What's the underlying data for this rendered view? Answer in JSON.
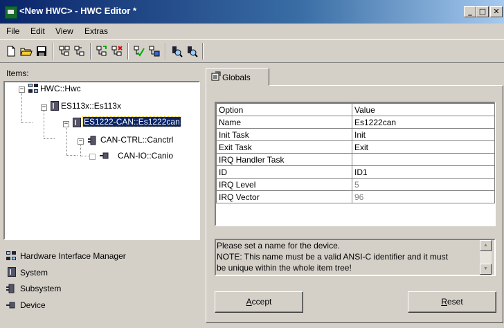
{
  "window": {
    "title": "<New HWC> - HWC Editor  *",
    "controls": {
      "minimize": "_",
      "maximize": "□",
      "close": "✕"
    }
  },
  "menu": [
    "File",
    "Edit",
    "View",
    "Extras"
  ],
  "toolbar": {
    "icons": [
      "new-file-icon",
      "open-folder-icon",
      "save-icon",
      "tree-add-icon",
      "tree-remove-icon",
      "tree-insert-icon",
      "tree-delete-icon",
      "check-icon",
      "build-icon",
      "find-icon",
      "find-next-icon"
    ]
  },
  "items_panel": {
    "label": "Items:",
    "tree": [
      {
        "label": "HWC::Hwc",
        "icon": "hwc-icon",
        "expander": "−"
      },
      {
        "label": "ES113x::Es113x",
        "icon": "system-icon",
        "expander": "−"
      },
      {
        "label": "ES1222-CAN::Es1222can",
        "icon": "system-icon",
        "expander": "−",
        "selected": true
      },
      {
        "label": "CAN-CTRL::Canctrl",
        "icon": "subsystem-icon",
        "expander": "−"
      },
      {
        "label": "CAN-IO::Canio",
        "icon": "device-icon",
        "expander": ""
      }
    ]
  },
  "legend": [
    {
      "label": "Hardware Interface Manager",
      "icon": "hwc-icon"
    },
    {
      "label": "System",
      "icon": "system-icon"
    },
    {
      "label": "Subsystem",
      "icon": "subsystem-icon"
    },
    {
      "label": "Device",
      "icon": "device-icon"
    }
  ],
  "tab": {
    "label": "Globals",
    "icon": "globals-icon"
  },
  "grid": {
    "headers": [
      "Option",
      "Value"
    ],
    "rows": [
      {
        "option": "Name",
        "value": "Es1222can",
        "disabled": false
      },
      {
        "option": "Init Task",
        "value": "Init",
        "disabled": false
      },
      {
        "option": "Exit Task",
        "value": "Exit",
        "disabled": false
      },
      {
        "option": "IRQ Handler Task",
        "value": "",
        "disabled": false
      },
      {
        "option": "ID",
        "value": "ID1",
        "disabled": false
      },
      {
        "option": "IRQ Level",
        "value": "5",
        "disabled": true
      },
      {
        "option": "IRQ Vector",
        "value": "96",
        "disabled": true
      }
    ]
  },
  "hint": {
    "lines": [
      "Please set a name for the device.",
      "NOTE: This name must be a valid ANSI-C identifier and it must",
      "be unique within the whole item tree!"
    ]
  },
  "buttons": {
    "accept": {
      "underline": "A",
      "rest": "ccept"
    },
    "reset": {
      "underline": "R",
      "rest": "eset"
    }
  },
  "colors": {
    "title_bar": "#0a246a",
    "selection": "#0a246a",
    "face": "#d4d0c8"
  }
}
